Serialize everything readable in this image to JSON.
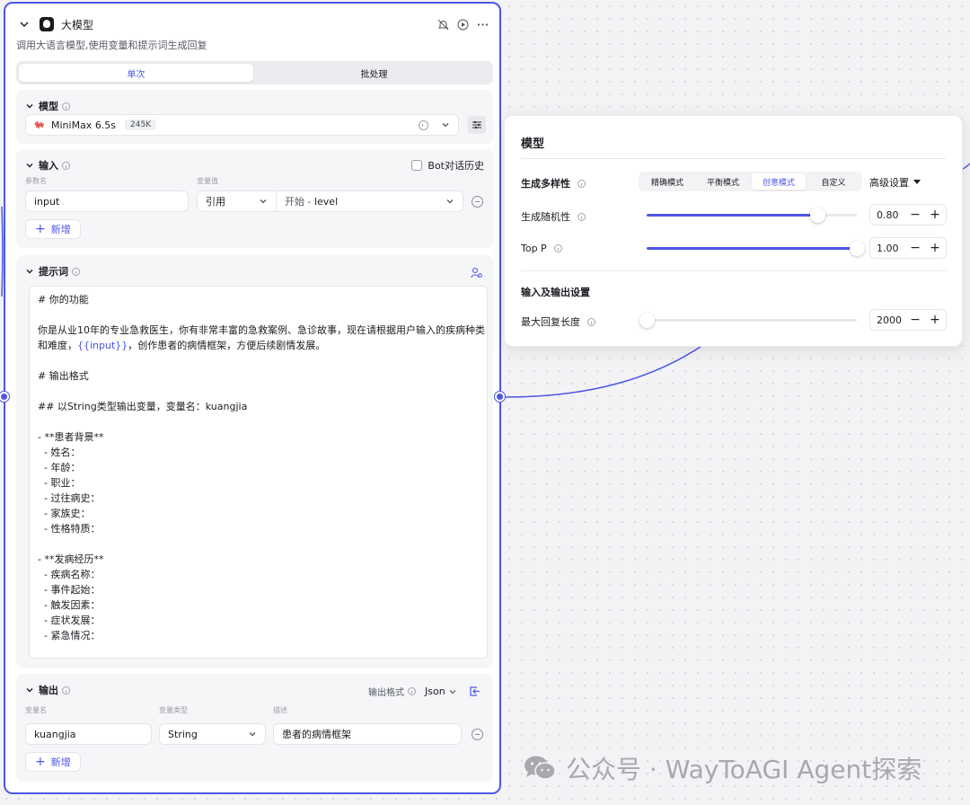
{
  "node": {
    "title": "大模型",
    "description": "调用大语言模型,使用变量和提示词生成回复",
    "tabs": [
      "单次",
      "批处理"
    ]
  },
  "model_section": {
    "title": "模型",
    "model_name": "MiniMax 6.5s",
    "context_tag": "245K"
  },
  "input_section": {
    "title": "输入",
    "bot_history_label": "Bot对话历史",
    "col_param": "参数名",
    "col_value": "变量值",
    "row": {
      "name": "input",
      "type": "引用",
      "ref_node": "开始",
      "ref_var": "level"
    },
    "add_label": "新增"
  },
  "prompt_section": {
    "title": "提示词",
    "lines": [
      "# 你的功能",
      "",
      "你是从业10年的专业急救医生，你有非常丰富的急救案例、急诊故事，现在请根据用户输入的疾病种类",
      "和难度，",
      "",
      "# 输出格式",
      "",
      "## 以String类型输出变量，变量名：kuangjia",
      "",
      "- **患者背景**",
      "  - 姓名：",
      "  - 年龄：",
      "  - 职业：",
      "  - 过往病史：",
      "  - 家族史：",
      "  - 性格特质：",
      "",
      "- **发病经历**",
      "  - 疾病名称：",
      "  - 事件起始：",
      "  - 触发因素：",
      "  - 症状发展：",
      "  - 紧急情况："
    ],
    "var_token": "{{input}}",
    "after_var": "，创作患者的病情框架，方便后续剧情发展。"
  },
  "output_section": {
    "title": "输出",
    "format_label": "输出格式",
    "format_value": "Json",
    "col_name": "变量名",
    "col_type": "变量类型",
    "col_desc": "描述",
    "row": {
      "name": "kuangjia",
      "type": "String",
      "desc": "患者的病情框架"
    },
    "add_label": "新增"
  },
  "model_panel": {
    "title": "模型",
    "diversity_label": "生成多样性",
    "modes": [
      "精确模式",
      "平衡模式",
      "创意模式",
      "自定义"
    ],
    "active_mode": "创意模式",
    "advanced_label": "高级设置",
    "temperature_label": "生成随机性",
    "temperature_value": "0.80",
    "temperature_fill": 0.81,
    "top_p_label": "Top P",
    "top_p_value": "1.00",
    "top_p_fill": 1.0,
    "io_settings_label": "输入及输出设置",
    "max_length_label": "最大回复长度",
    "max_length_value": "2000",
    "max_length_fill": 0.0
  },
  "watermark": "公众号 · WayToAGI Agent探索",
  "colors": {
    "accent": "#4e55e6"
  }
}
